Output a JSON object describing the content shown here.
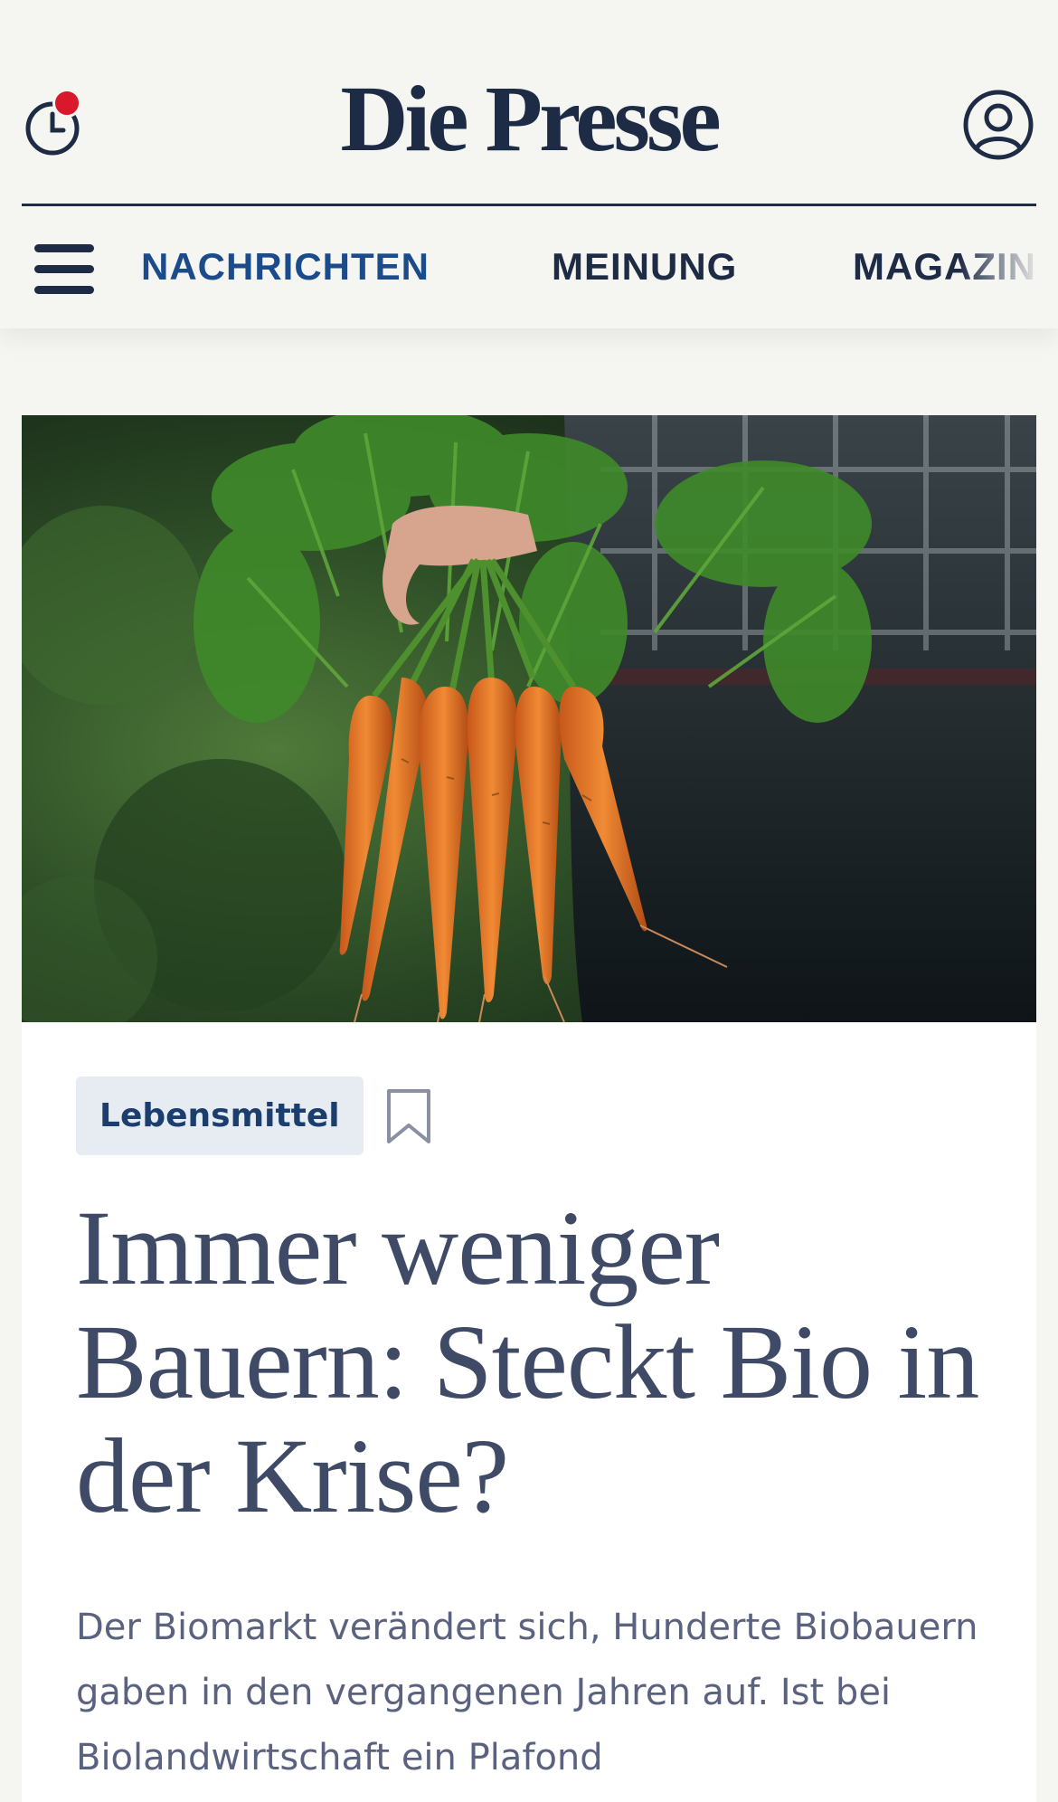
{
  "header": {
    "logo": "Die Presse",
    "history_icon": "clock-history-icon",
    "account_icon": "user-account-icon",
    "notification_color": "#d9182b"
  },
  "nav": {
    "menu_icon": "hamburger-menu-icon",
    "items": [
      {
        "label": "NACHRICHTEN",
        "active": true
      },
      {
        "label": "MEINUNG",
        "active": false
      },
      {
        "label": "MAGAZIN",
        "active": false
      }
    ]
  },
  "article": {
    "category": "Lebensmittel",
    "bookmark_icon": "bookmark-icon",
    "headline": "Immer weniger Bauern: Steckt Bio in der Krise?",
    "lead": "Der Biomarkt verändert sich, Hunderte Biobauern gaben in den vergangenen Jahren auf. Ist bei Biolandwirtschaft ein Plafond"
  },
  "colors": {
    "brand": "#1e2b45",
    "nav_active": "#1b4b8a",
    "tag_bg": "#e7ebf2",
    "page_bg": "#f5f5f2"
  }
}
